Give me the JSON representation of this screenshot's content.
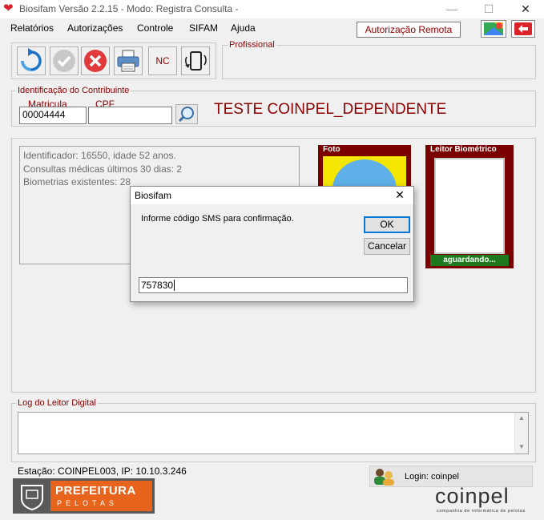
{
  "window": {
    "title": "Biosifam Versão 2.2.15 - Modo: Registra Consulta -",
    "minimize_glyph": "—",
    "maximize_glyph": "☐",
    "close_glyph": "✕"
  },
  "menu": {
    "items": [
      "Relatórios",
      "Autorizações",
      "Controle",
      "SIFAM",
      "Ajuda"
    ],
    "autorizacao_remota": "Autorização Remota"
  },
  "toolbar": {
    "nc_label": "NC"
  },
  "profissional": {
    "label": "Profissional"
  },
  "identificacao": {
    "label": "Identificação do Contribuinte",
    "matricula_label": "Matricula",
    "matricula_value": "00004444",
    "cpf_label": "CPF",
    "cpf_value": "",
    "contribuinte_nome": "TESTE COINPEL_DEPENDENTE"
  },
  "info": {
    "lines": [
      "Identificador: 16550, idade 52 anos.",
      "Consultas médicas últimos 30 dias: 2",
      "Biometrias existentes: 28"
    ]
  },
  "foto": {
    "label": "Foto"
  },
  "leitor": {
    "label": "Leitor Biométrico",
    "status": "aguardando..."
  },
  "dialog": {
    "title": "Biosifam",
    "close_glyph": "✕",
    "message": "Informe código SMS para confirmação.",
    "ok_label": "OK",
    "cancel_label": "Cancelar",
    "input_value": "757830"
  },
  "log": {
    "label": "Log do Leitor Digital"
  },
  "footer": {
    "estacao": "Estação: COINPEL003, IP: 10.10.3.246",
    "login": "Login: coinpel",
    "prefeitura": "PREFEITURA",
    "pelotas": "PELOTAS",
    "coinpel": "coinpel",
    "coinpel_sub": "companhia de informática de pelotas"
  },
  "colors": {
    "accent_red": "#8b0000",
    "frame_red": "#7a0000",
    "status_green": "#1f7a1f",
    "prefeitura_orange": "#e8631c"
  }
}
